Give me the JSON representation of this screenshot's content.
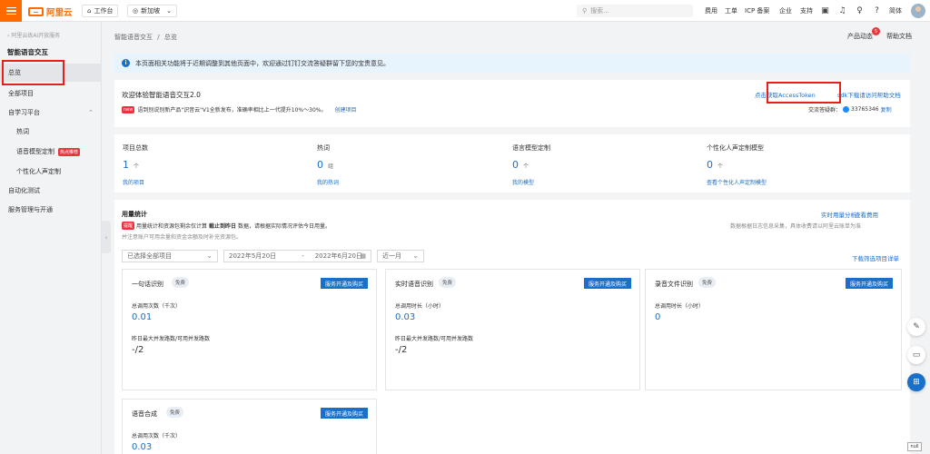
{
  "topbar": {
    "logo_text": "阿里云",
    "workbench": "工作台",
    "region": "新加坡",
    "search_placeholder": "搜索...",
    "nav": [
      "费用",
      "工单",
      "ICP 备案",
      "企业",
      "支持"
    ],
    "user": "简体"
  },
  "sidebar": {
    "back_label": "阿里云练AI开放服务",
    "title": "智能语音交互",
    "items": [
      {
        "label": "总览",
        "active": true
      },
      {
        "label": "全部项目"
      },
      {
        "label": "自学习平台",
        "expandable": true
      },
      {
        "label": "热词",
        "sub": true
      },
      {
        "label": "语音模型定制",
        "sub": true,
        "badge": "热点推荐"
      },
      {
        "label": "个性化人声定制",
        "sub": true
      },
      {
        "label": "自动化测试"
      },
      {
        "label": "服务管理与开通"
      }
    ]
  },
  "breadcrumb": {
    "parent": "智能语音交互",
    "sep": "/",
    "current": "总览"
  },
  "header_links": {
    "news": "产品动态",
    "news_count": "5",
    "help": "帮助文档"
  },
  "notice": {
    "text": "本页面相关功能将于近期调整到其他页面中，欢迎通过钉钉交流答疑群留下您的宝贵意见。"
  },
  "welcome": {
    "title": "欢迎体验智能语音交互2.0",
    "new_badge": "new",
    "news": "语到别说别新产品\"识音云\"V1全新发布，准确率相比上一代提升10%～30%。",
    "create_link": "创建项目",
    "token_link": "点击获取AccessToken",
    "sdk_link": "sdk下载请访问帮助文档",
    "group_label": "交流答疑群：",
    "group_number": "33765346",
    "copy_link": "复制"
  },
  "stats": [
    {
      "label": "项目总数",
      "value": "1",
      "unit": "个",
      "link": "我的项目"
    },
    {
      "label": "热词",
      "value": "0",
      "unit": "组",
      "link": "我的热词"
    },
    {
      "label": "语言模型定制",
      "value": "0",
      "unit": "个",
      "link": "我的模型"
    },
    {
      "label": "个性化人声定制模型",
      "value": "0",
      "unit": "个",
      "link": "查看个性化人声定制模型"
    }
  ],
  "usage": {
    "title": "用量统计",
    "tip_badge": "提醒",
    "tip_text_a": "用量统计和资源包剩余仅计算",
    "tip_text_bold": "截止到昨日",
    "tip_text_b": "数据，请根据实际情况评估今日用量。",
    "tip_text_line2": "并注意账户可用余量和资金余额及时补充资源包。",
    "realtime_link": "实时用量分析",
    "bill_link": "查看费用",
    "right_note": "数据根据日志信息采集，具体收费请以阿里云账单为准",
    "project_select": "已选择全部项目",
    "date_start": "2022年5月20日",
    "date_sep": "-",
    "date_end": "2022年6月20日",
    "range_select": "近一月",
    "download_link": "下载筛选项目详单"
  },
  "services": [
    {
      "title": "一句话识别",
      "free": "免费",
      "button": "服务开通及购买",
      "label1": "总调用次数（千次）",
      "value1": "0.01",
      "label2": "昨日最大并发路数/可用并发路数",
      "value2": "-/2"
    },
    {
      "title": "实时语音识别",
      "free": "免费",
      "button": "服务开通及购买",
      "label1": "总调用时长（小时）",
      "value1": "0.03",
      "label2": "昨日最大并发路数/可用并发路数",
      "value2": "-/2"
    },
    {
      "title": "录音文件识别",
      "free": "免费",
      "button": "服务开通及购买",
      "label1": "总调用时长（小时）",
      "value1": "0"
    },
    {
      "title": "语音合成",
      "free": "免费",
      "button": "服务开通及购买",
      "label1": "总调用次数（千次）",
      "value1": "0.03"
    }
  ],
  "null_tag": "null",
  "colors": {
    "brand": "#ff6a00",
    "link": "#1a6fc9",
    "highlight": "#e5201b"
  }
}
